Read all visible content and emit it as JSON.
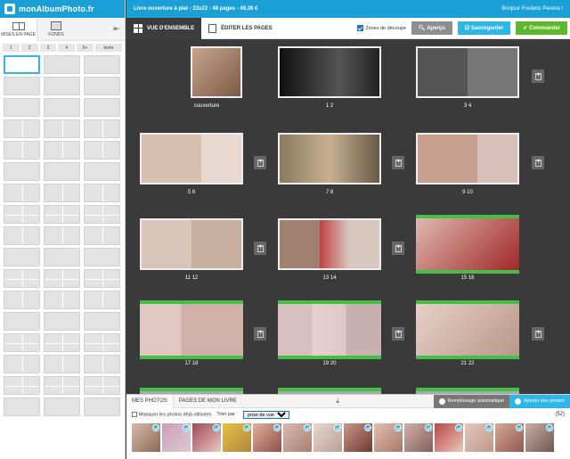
{
  "app": {
    "logo": "monAlbumPhoto.fr"
  },
  "topbar": {
    "book_info": "Livre ouverture à plat - 22x22 - 48 pages - 49,39 €",
    "greeting": "Bonjour Frederic Pereira !"
  },
  "sidebar": {
    "tabs": [
      {
        "label": "MISES EN PAGE"
      },
      {
        "label": "FONDS"
      }
    ],
    "filters": [
      "1",
      "2",
      "3",
      "4",
      "5+",
      "texte"
    ]
  },
  "toolbar": {
    "view_overview": "VUE D'ENSEMBLE",
    "view_edit": "ÉDITER LES PAGES",
    "zones_label": "Zones de découpe",
    "preview_label": "Aperçu",
    "save_label": "Sauvegarder",
    "order_label": "Commander"
  },
  "spreads": [
    {
      "label": "couverture"
    },
    {
      "label": "1  2"
    },
    {
      "label": "3  4"
    },
    {
      "label": "5  6"
    },
    {
      "label": "7  8"
    },
    {
      "label": "9  10"
    },
    {
      "label": "11  12"
    },
    {
      "label": "13  14"
    },
    {
      "label": "15  16"
    },
    {
      "label": "17  18"
    },
    {
      "label": "19  20"
    },
    {
      "label": "21  22"
    }
  ],
  "bottom": {
    "tab_photos": "MES PHOTOS",
    "tab_pages": "PAGES DE MON LIVRE",
    "auto_fill": "Remplissage automatique",
    "add_photos": "Ajouter des photos",
    "hide_used": "Masquer les photos déjà utilisées",
    "sort_label": "Trier par :",
    "sort_value": "prise de vue",
    "count": "(52)"
  }
}
